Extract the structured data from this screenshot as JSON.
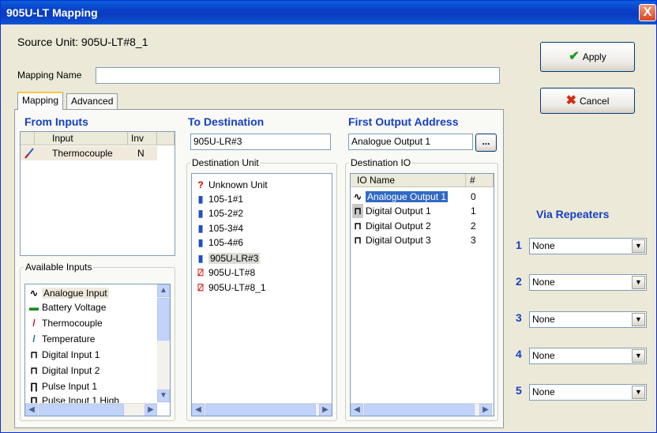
{
  "window": {
    "title": "905U-LT Mapping",
    "close_label": "X"
  },
  "source_unit": "Source Unit: 905U-LT#8_1",
  "mapping_name": {
    "label": "Mapping Name",
    "value": ""
  },
  "buttons": {
    "apply": "Apply",
    "cancel": "Cancel",
    "browse": "..."
  },
  "tabs": [
    {
      "label": "Mapping",
      "active": true
    },
    {
      "label": "Advanced",
      "active": false
    }
  ],
  "from_inputs": {
    "heading": "From Inputs",
    "columns": [
      "Input",
      "Inv"
    ],
    "rows": [
      {
        "icon": "thermocouple-icon",
        "input": "Thermocouple",
        "inv": "N"
      }
    ]
  },
  "available_inputs": {
    "label": "Available Inputs",
    "items": [
      {
        "icon": "analogue-icon",
        "label": "Analogue Input"
      },
      {
        "icon": "battery-icon",
        "label": "Battery Voltage"
      },
      {
        "icon": "thermocouple-icon",
        "label": "Thermocouple"
      },
      {
        "icon": "temperature-icon",
        "label": "Temperature"
      },
      {
        "icon": "digital-icon",
        "label": "Digital Input 1"
      },
      {
        "icon": "digital-icon",
        "label": "Digital Input 2"
      },
      {
        "icon": "pulse-icon",
        "label": "Pulse Input 1"
      },
      {
        "icon": "pulse-icon",
        "label": "Pulse Input 1 High"
      }
    ]
  },
  "to_destination": {
    "heading": "To Destination",
    "value": "905U-LR#3",
    "group_label": "Destination Unit",
    "items": [
      {
        "icon": "unknown-icon",
        "label": "Unknown Unit"
      },
      {
        "icon": "unit-icon",
        "label": "105-1#1"
      },
      {
        "icon": "unit-icon",
        "label": "105-2#2"
      },
      {
        "icon": "unit-icon",
        "label": "105-3#4"
      },
      {
        "icon": "unit-icon",
        "label": "105-4#6"
      },
      {
        "icon": "radio-unit-icon",
        "label": "905U-LR#3"
      },
      {
        "icon": "disabled-unit-icon",
        "label": "905U-LT#8"
      },
      {
        "icon": "disabled-unit-icon",
        "label": "905U-LT#8_1"
      }
    ]
  },
  "first_output": {
    "heading": "First Output Address",
    "value": "Analogue Output 1",
    "group_label": "Destination IO",
    "columns": [
      "IO Name",
      "#"
    ],
    "rows": [
      {
        "icon": "analogue-icon",
        "name": "Analogue Output 1",
        "num": "0"
      },
      {
        "icon": "digital-icon",
        "name": "Digital Output 1",
        "num": "1"
      },
      {
        "icon": "digital-icon",
        "name": "Digital Output 2",
        "num": "2"
      },
      {
        "icon": "digital-icon",
        "name": "Digital Output 3",
        "num": "3"
      }
    ]
  },
  "via_repeaters": {
    "heading": "Via Repeaters",
    "items": [
      {
        "num": "1",
        "value": "None"
      },
      {
        "num": "2",
        "value": "None"
      },
      {
        "num": "3",
        "value": "None"
      },
      {
        "num": "4",
        "value": "None"
      },
      {
        "num": "5",
        "value": "None"
      }
    ]
  }
}
